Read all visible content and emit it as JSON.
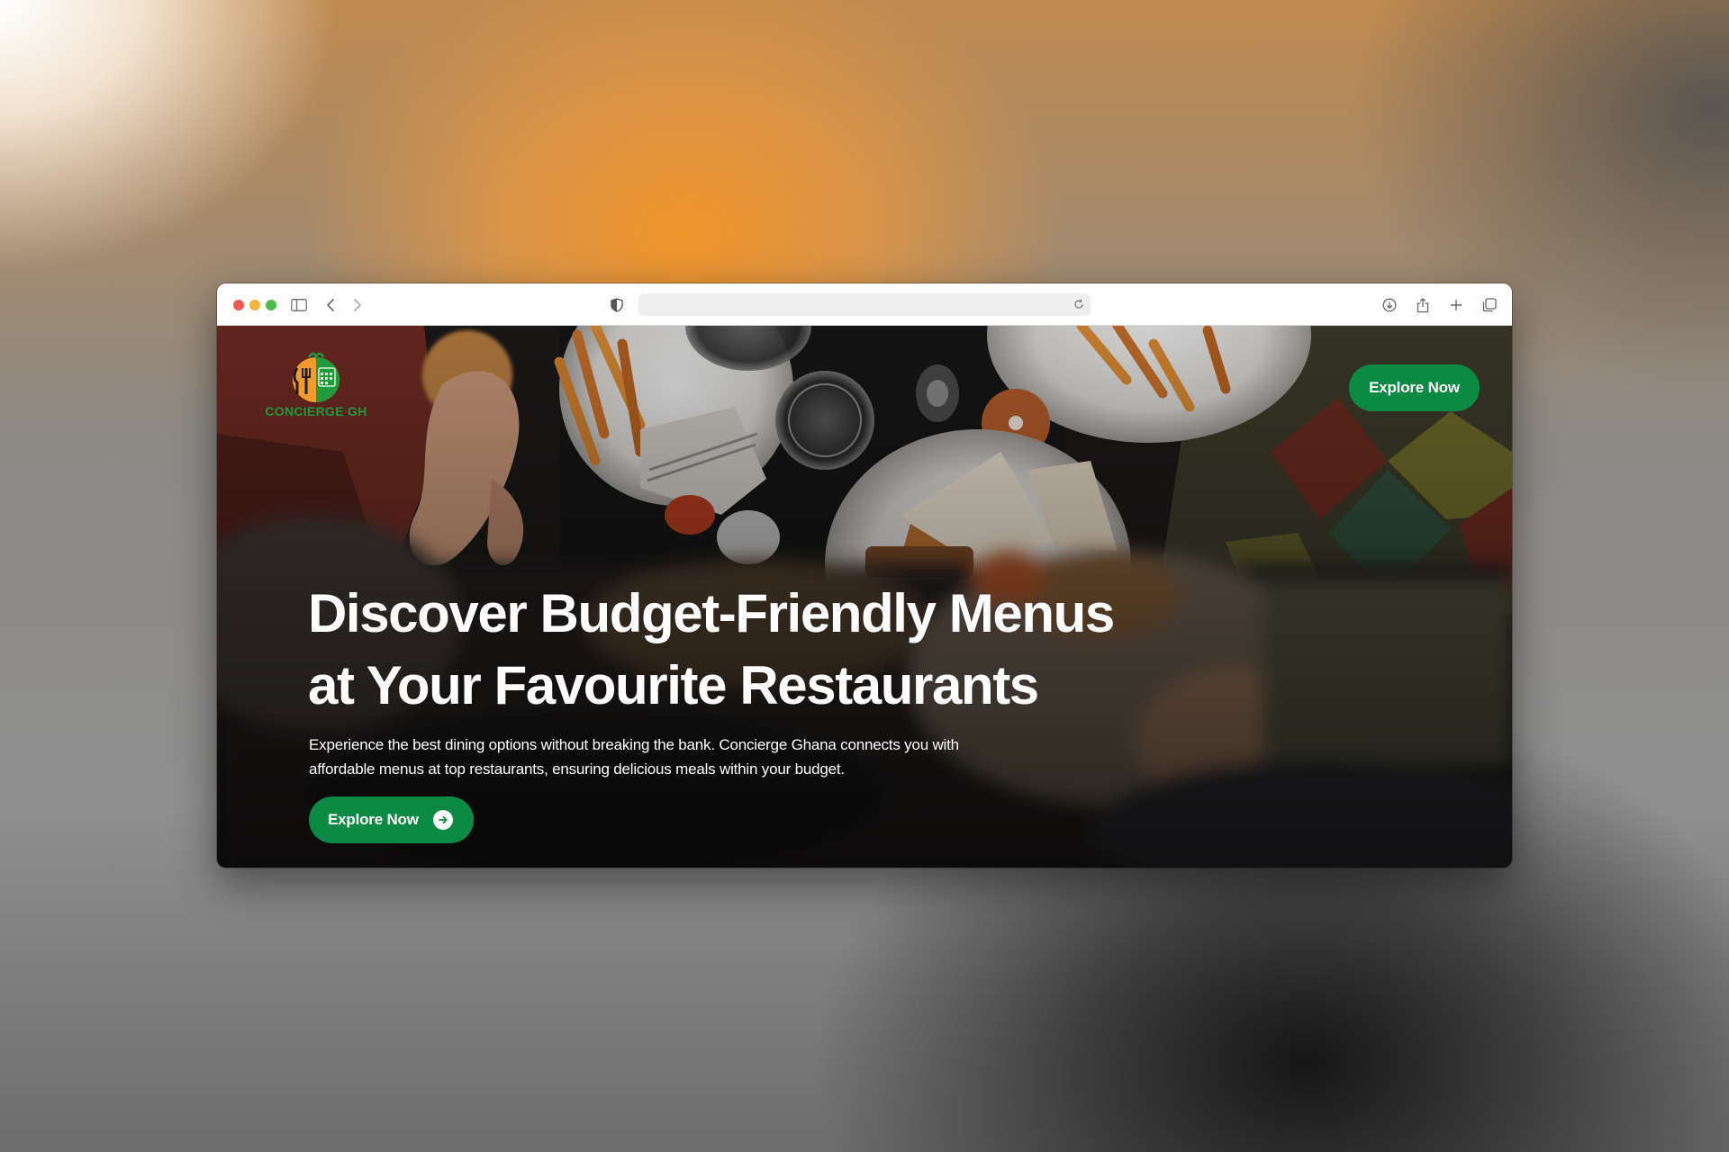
{
  "browser": {
    "traffic_lights": {
      "close_color": "#ee5b52",
      "minimize_color": "#f2b53a",
      "zoom_color": "#4fba48"
    },
    "address_bar": {
      "url": ""
    },
    "icons": [
      "sidebar-icon",
      "back-icon",
      "forward-icon",
      "privacy-shield-icon",
      "reload-icon",
      "download-icon",
      "share-icon",
      "new-tab-icon",
      "tab-overview-icon"
    ]
  },
  "site": {
    "logo": {
      "text": "CONCIERGE GH",
      "icon": "fork-knife-calendar-icon"
    },
    "nav": {
      "cta_label": "Explore Now"
    },
    "hero": {
      "headline_line1": "Discover Budget-Friendly Menus",
      "headline_line2": "at Your Favourite Restaurants",
      "description_line1": "Experience the best dining options without breaking the bank. Concierge Ghana connects you with",
      "description_line2": "affordable menus at top restaurants, ensuring delicious meals within your budget.",
      "cta_label": "Explore Now",
      "cta_icon": "arrow-right-circle-icon"
    },
    "colors": {
      "primary_green": "#0c8a44",
      "logo_orange": "#f29a2b",
      "logo_green": "#1f9a3c"
    }
  }
}
